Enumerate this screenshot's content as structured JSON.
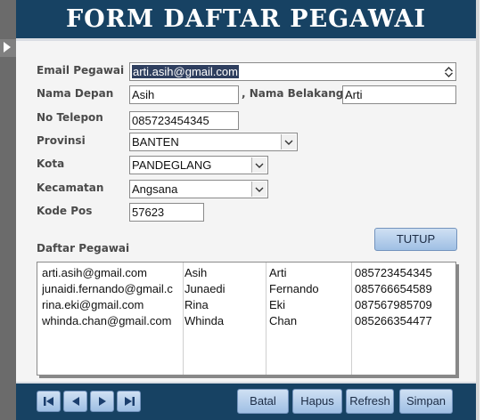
{
  "header": {
    "title": "FORM DAFTAR PEGAWAI"
  },
  "form": {
    "email_label": "Email Pegawai",
    "email_value": "arti.asih@gmail.com",
    "nama_depan_label": "Nama Depan",
    "nama_depan_value": "Asih",
    "nama_belakang_label": ", Nama Belakang",
    "nama_belakang_value": "Arti",
    "telepon_label": "No Telepon",
    "telepon_value": "085723454345",
    "provinsi_label": "Provinsi",
    "provinsi_value": "BANTEN",
    "kota_label": "Kota",
    "kota_value": "PANDEGLANG",
    "kecamatan_label": "Kecamatan",
    "kecamatan_value": "Angsana",
    "kodepos_label": "Kode Pos",
    "kodepos_value": "57623"
  },
  "list": {
    "title": "Daftar Pegawai",
    "close_button": "TUTUP",
    "rows": [
      [
        "arti.asih@gmail.com",
        "Asih",
        "Arti",
        "085723454345"
      ],
      [
        "junaidi.fernando@gmail.c",
        "Junaedi",
        "Fernando",
        "085766654589"
      ],
      [
        "rina.eki@gmail.com",
        "Rina",
        "Eki",
        "087567985709"
      ],
      [
        "whinda.chan@gmail.com",
        "Whinda",
        "Chan",
        "085266354477"
      ]
    ]
  },
  "footer": {
    "first_icon": "first-record-icon",
    "prev_icon": "previous-record-icon",
    "next_icon": "next-record-icon",
    "last_icon": "last-record-icon",
    "batal": "Batal",
    "hapus": "Hapus",
    "refresh": "Refresh",
    "simpan": "Simpan"
  },
  "colors": {
    "header_bg": "#174263",
    "button_bg": "#b6cfee",
    "selection_bg": "#2f3f5f"
  }
}
